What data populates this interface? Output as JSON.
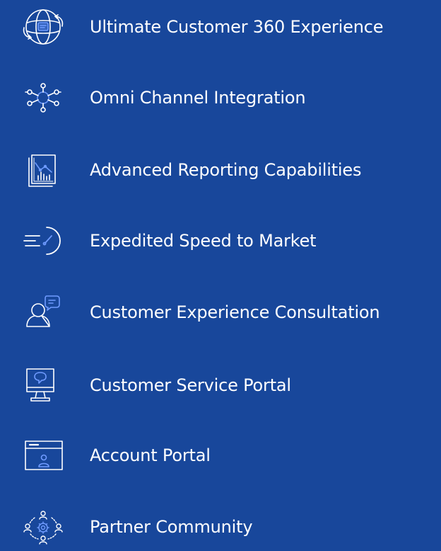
{
  "features": [
    {
      "label": "Ultimate Customer 360 Experience",
      "icon": "customer-360-icon"
    },
    {
      "label": "Omni Channel Integration",
      "icon": "network-nodes-icon"
    },
    {
      "label": "Advanced Reporting Capabilities",
      "icon": "report-chart-icon"
    },
    {
      "label": "Expedited Speed to Market",
      "icon": "speedometer-icon"
    },
    {
      "label": "Customer Experience Consultation",
      "icon": "person-chat-icon"
    },
    {
      "label": "Customer Service Portal",
      "icon": "monitor-chat-icon"
    },
    {
      "label": "Account Portal",
      "icon": "browser-account-icon"
    },
    {
      "label": "Partner Community",
      "icon": "community-network-icon"
    }
  ],
  "colors": {
    "background": "#18479B",
    "icon_stroke": "#ffffff",
    "icon_accent": "#4A7BE0",
    "text": "#ffffff"
  }
}
